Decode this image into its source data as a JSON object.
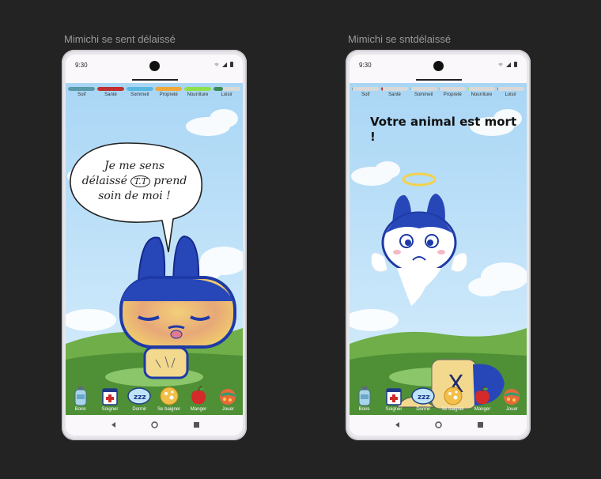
{
  "screens": [
    {
      "frame_title": "Mimichi se sent délaissé",
      "status_time": "9:30",
      "stats": [
        {
          "label": "Soif",
          "level": 1.0,
          "color": "#5a9aaa"
        },
        {
          "label": "Santé",
          "level": 1.0,
          "color": "#c0302f"
        },
        {
          "label": "Sommeil",
          "level": 1.0,
          "color": "#5ab8e0"
        },
        {
          "label": "Propreté",
          "level": 1.0,
          "color": "#f0a83a"
        },
        {
          "label": "Nourriture",
          "level": 1.0,
          "color": "#8fe04a"
        },
        {
          "label": "Loisir",
          "level": 0.35,
          "color": "#3c8a5a"
        }
      ],
      "speech": {
        "line1": "Je me sens",
        "line2": "délaissé",
        "emote": "T.T",
        "line2b": "prend",
        "line3": "soin de moi !"
      },
      "actions": [
        {
          "label": "Boire",
          "icon": "water-bottle-icon"
        },
        {
          "label": "Soigner",
          "icon": "first-aid-icon"
        },
        {
          "label": "Dormir",
          "icon": "sleep-zzz-icon"
        },
        {
          "label": "Se baigner",
          "icon": "sponge-icon"
        },
        {
          "label": "Manger",
          "icon": "apple-icon"
        },
        {
          "label": "Jouer",
          "icon": "ball-icon"
        }
      ]
    },
    {
      "frame_title": "Mimichi se sntdélaissé",
      "status_time": "9:30",
      "stats": [
        {
          "label": "Soif",
          "level": 0.03,
          "color": "#5a9aaa"
        },
        {
          "label": "Santé",
          "level": 0.05,
          "color": "#c0302f"
        },
        {
          "label": "Sommeil",
          "level": 0.03,
          "color": "#5ab8e0"
        },
        {
          "label": "Propreté",
          "level": 0.03,
          "color": "#f0a83a"
        },
        {
          "label": "Nourriture",
          "level": 0.03,
          "color": "#8fe04a"
        },
        {
          "label": "Loisir",
          "level": 0.03,
          "color": "#3c8a5a"
        }
      ],
      "dead_message": "Votre animal est mort !",
      "tombstone_mark": "X",
      "actions": [
        {
          "label": "Boire",
          "icon": "water-bottle-icon"
        },
        {
          "label": "Soigner",
          "icon": "first-aid-icon"
        },
        {
          "label": "Dormir",
          "icon": "sleep-zzz-icon"
        },
        {
          "label": "Se baigner",
          "icon": "sponge-icon"
        },
        {
          "label": "Manger",
          "icon": "apple-icon"
        },
        {
          "label": "Jouer",
          "icon": "ball-icon"
        }
      ]
    }
  ]
}
